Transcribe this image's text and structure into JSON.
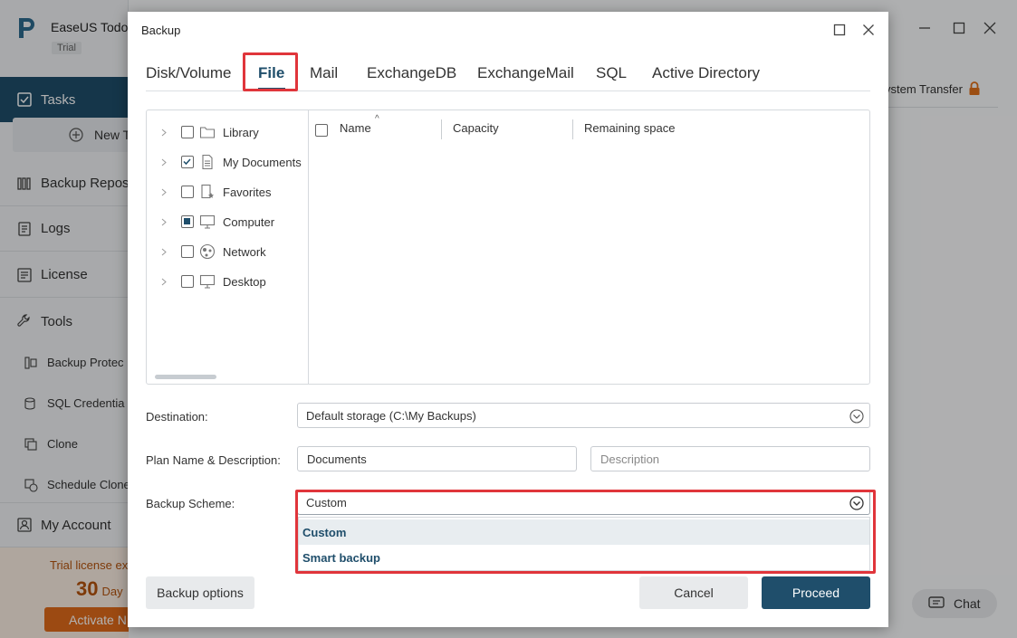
{
  "app": {
    "title": "EaseUS Todo",
    "badge": "Trial",
    "nav": {
      "tasks": "Tasks",
      "new_task": "New T",
      "backup_repos": "Backup Repos",
      "logs": "Logs",
      "license": "License",
      "tools": "Tools",
      "my_account": "My Account"
    },
    "tools_items": [
      "Backup Protec",
      "SQL Credentia",
      "Clone",
      "Schedule Clone"
    ],
    "trial": {
      "text": "Trial license exp",
      "days_number": "30",
      "days_unit": "Day",
      "activate": "Activate N"
    },
    "system_transfer": "ystem Transfer",
    "chat": "Chat",
    "accent_color": "#1f4e6b",
    "highlight_color": "#e0353b"
  },
  "dialog": {
    "title": "Backup",
    "tabs": [
      "Disk/Volume",
      "File",
      "Mail",
      "ExchangeDB",
      "ExchangeMail",
      "SQL",
      "Active Directory"
    ],
    "active_tab": "File",
    "tree": [
      {
        "label": "Library",
        "state": "unchecked",
        "icon": "folder-icon"
      },
      {
        "label": "My Documents",
        "state": "checked",
        "icon": "document-icon"
      },
      {
        "label": "Favorites",
        "state": "unchecked",
        "icon": "favorites-icon"
      },
      {
        "label": "Computer",
        "state": "partial",
        "icon": "computer-icon"
      },
      {
        "label": "Network",
        "state": "unchecked",
        "icon": "network-icon"
      },
      {
        "label": "Desktop",
        "state": "unchecked",
        "icon": "desktop-icon"
      }
    ],
    "columns": {
      "name": "Name",
      "capacity": "Capacity",
      "remaining": "Remaining space"
    },
    "sort_indicator": "^",
    "destination": {
      "label": "Destination:",
      "value": "Default storage (C:\\My Backups)"
    },
    "plan": {
      "label": "Plan Name & Description:",
      "name_value": "Documents",
      "description_placeholder": "Description"
    },
    "scheme": {
      "label": "Backup Scheme:",
      "value": "Custom",
      "options": [
        "Custom",
        "Smart backup"
      ],
      "selected": "Custom"
    },
    "buttons": {
      "options": "Backup options",
      "cancel": "Cancel",
      "proceed": "Proceed"
    }
  }
}
